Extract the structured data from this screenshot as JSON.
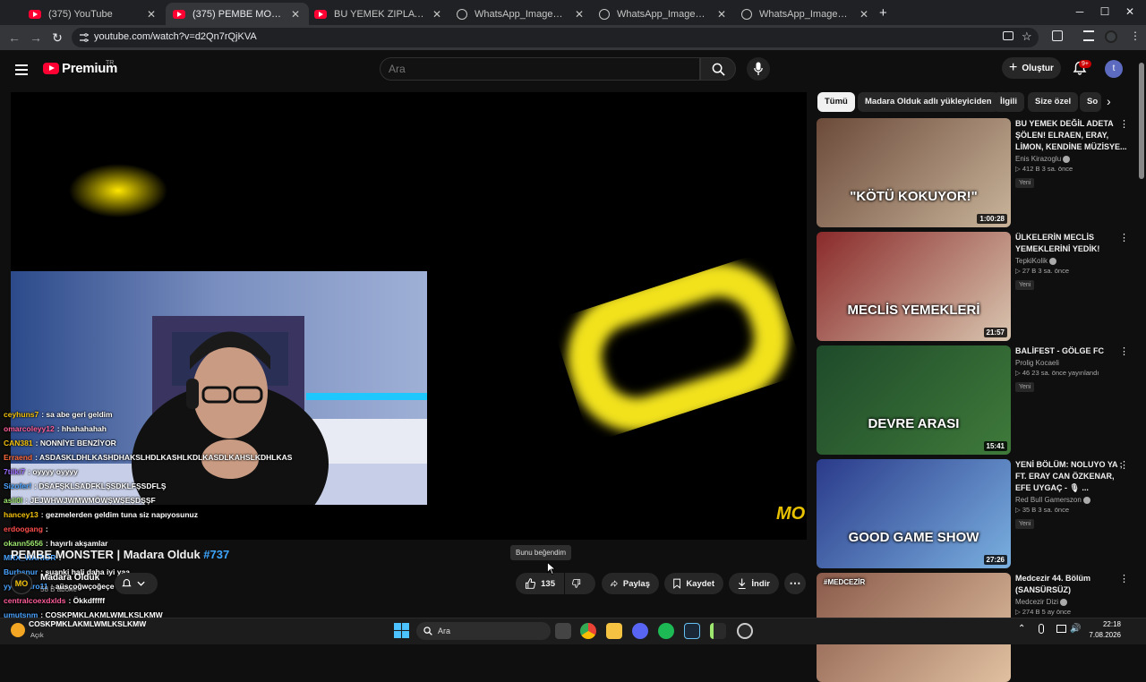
{
  "browser": {
    "tabs": [
      {
        "title": "(375) YouTube",
        "active": false,
        "icon": "youtube-icon"
      },
      {
        "title": "(375) PEMBE MONSTER | Madara Olduk",
        "active": true,
        "icon": "youtube-icon"
      },
      {
        "title": "BU YEMEK ZIPLATIR! ELRAEN, ERAY",
        "active": false,
        "icon": "youtube-icon"
      },
      {
        "title": "WhatsApp_Image_2026-08-07_",
        "active": false,
        "icon": "globe-icon"
      },
      {
        "title": "WhatsApp_Image_2026-08-07_",
        "active": false,
        "icon": "globe-icon"
      },
      {
        "title": "WhatsApp_Image_2026-08-07_",
        "active": false,
        "icon": "globe-icon"
      }
    ],
    "new_tab": "+",
    "url": "youtube.com/watch?v=d2Qn7rQjKVA"
  },
  "header": {
    "logo": "Premium",
    "logo_region": "TR",
    "search_placeholder": "Ara",
    "create_label": "Oluştur",
    "notifications_badge": "9+",
    "avatar_letter": "t"
  },
  "chat": [
    {
      "user": "ceyhuns7",
      "color": "#f4c20d",
      "msg": "sa abe geri geldim"
    },
    {
      "user": "omarcoleyy12",
      "color": "#ff5e9a",
      "msg": "hhahahahah"
    },
    {
      "user": "CAN381",
      "color": "#f4c20d",
      "msg": "NONNİYE BENZİYOR"
    },
    {
      "user": "Erraend",
      "color": "#ff6b3d",
      "msg": "ASDASKLDHLKASHDHAKSLHDLKASHLKDLKASDLKAHSLKDHLKAS"
    },
    {
      "user": "7tilki7",
      "color": "#9b6bff",
      "msg": "oyyyy oyyyy"
    },
    {
      "user": "Sizofer!",
      "color": "#4aa3ff",
      "msg": "DSAFŞKLSADFKLŞSDKLFŞSDFLŞ"
    },
    {
      "user": "asli0l",
      "color": "#9fe870",
      "msg": "JEJWHWJWMWMÖWŞWŞEŞDŞŞF"
    },
    {
      "user": "hancey13",
      "color": "#f4c20d",
      "msg": "gezmelerden geldim tuna siz napıyosunuz"
    },
    {
      "user": "erdoogang",
      "color": "#ff4d4d",
      "msg": ""
    },
    {
      "user": "okann5656",
      "color": "#9fe870",
      "msg": "hayırlı akşamlar"
    },
    {
      "user": "MRX_WARIOR",
      "color": "#4aa3ff",
      "msg": ""
    },
    {
      "user": "Burbsnur",
      "color": "#4aa3ff",
      "msg": "şuanki hali daha iyi yaa"
    },
    {
      "user": "yyagmuro11",
      "color": "#4aa3ff",
      "msg": "aüsçoğwçoğeçe"
    },
    {
      "user": "centralcoexdxlds",
      "color": "#ff5e9a",
      "msg": "Ökkdfffff"
    },
    {
      "user": "umutsnm",
      "color": "#4aa3ff",
      "msg": "COSKPMKLAKMLWMLKSLKMW"
    }
  ],
  "video": {
    "title": "PEMBE MONSTER | Madara Olduk",
    "tag": "#737",
    "channel": "Madara Olduk",
    "channel_initials": "MO",
    "subscribers": "58 B abone",
    "likes": "135",
    "share": "Paylaş",
    "save": "Kaydet",
    "download": "İndir",
    "like_tooltip": "Bunu beğendim",
    "watermark": "MO"
  },
  "chips": [
    "Tümü",
    "Madara Olduk adlı yükleyiciden",
    "İlgili",
    "Size özel",
    "So"
  ],
  "recommendations": [
    {
      "title": "BU YEMEK DEĞİL ADETA ŞÖLEN! ELRAEN, ERAY, LİMON, KENDİNE MÜZİSYE...",
      "channel": "Enis Kirazoglu",
      "verified": true,
      "views": "412 B",
      "age": "3 sa. önce",
      "badge": "Yeni",
      "duration": "1:00:28",
      "thumb_text": "\"KÖTÜ KOKUYOR!\"",
      "colors": [
        "#6b4a3a",
        "#c9b49a"
      ]
    },
    {
      "title": "ÜLKELERİN MECLİS YEMEKLERİNİ YEDİK!",
      "channel": "TepkiKolik",
      "verified": true,
      "views": "27 B",
      "age": "3 sa. önce",
      "badge": "Yeni",
      "duration": "21:57",
      "thumb_text": "MECLİS YEMEKLERİ",
      "colors": [
        "#8a2a2a",
        "#d9c6b0"
      ]
    },
    {
      "title": "BALİFEST - GÖLGE FC",
      "channel": "Prolig Kocaeli",
      "verified": false,
      "views": "46",
      "age": "23 sa. önce yayınlandı",
      "badge": "Yeni",
      "duration": "15:41",
      "thumb_text": "DEVRE ARASI",
      "colors": [
        "#1e4a2a",
        "#3f7a3a"
      ]
    },
    {
      "title": "YENİ BÖLÜM: NOLUYO YA ; FT. ERAY CAN ÖZKENAR, EFE UYGAÇ - 🎙 ...",
      "channel": "Red Bull Gamerszon",
      "verified": true,
      "views": "35 B",
      "age": "3 sa. önce",
      "badge": "Yeni",
      "duration": "27:26",
      "thumb_text": "GOOD GAME SHOW",
      "colors": [
        "#2a3a8a",
        "#7ab0e0"
      ]
    },
    {
      "title": "Medcezir 44. Bölüm (SANSÜRSÜZ)",
      "channel": "Medcezir Dizi",
      "verified": true,
      "views": "274 B",
      "age": "5 ay önce",
      "badge": "",
      "duration": "",
      "thumb_text": "#MEDCEZİR",
      "colors": [
        "#8a5a4a",
        "#e0c0a0"
      ]
    }
  ],
  "taskbar": {
    "weather": "COSKPMKLAKMLWMLKSLKMW",
    "weather_sub": "Açık",
    "search_label": "Ara",
    "time": "22:18",
    "date": "7.08.2026"
  }
}
